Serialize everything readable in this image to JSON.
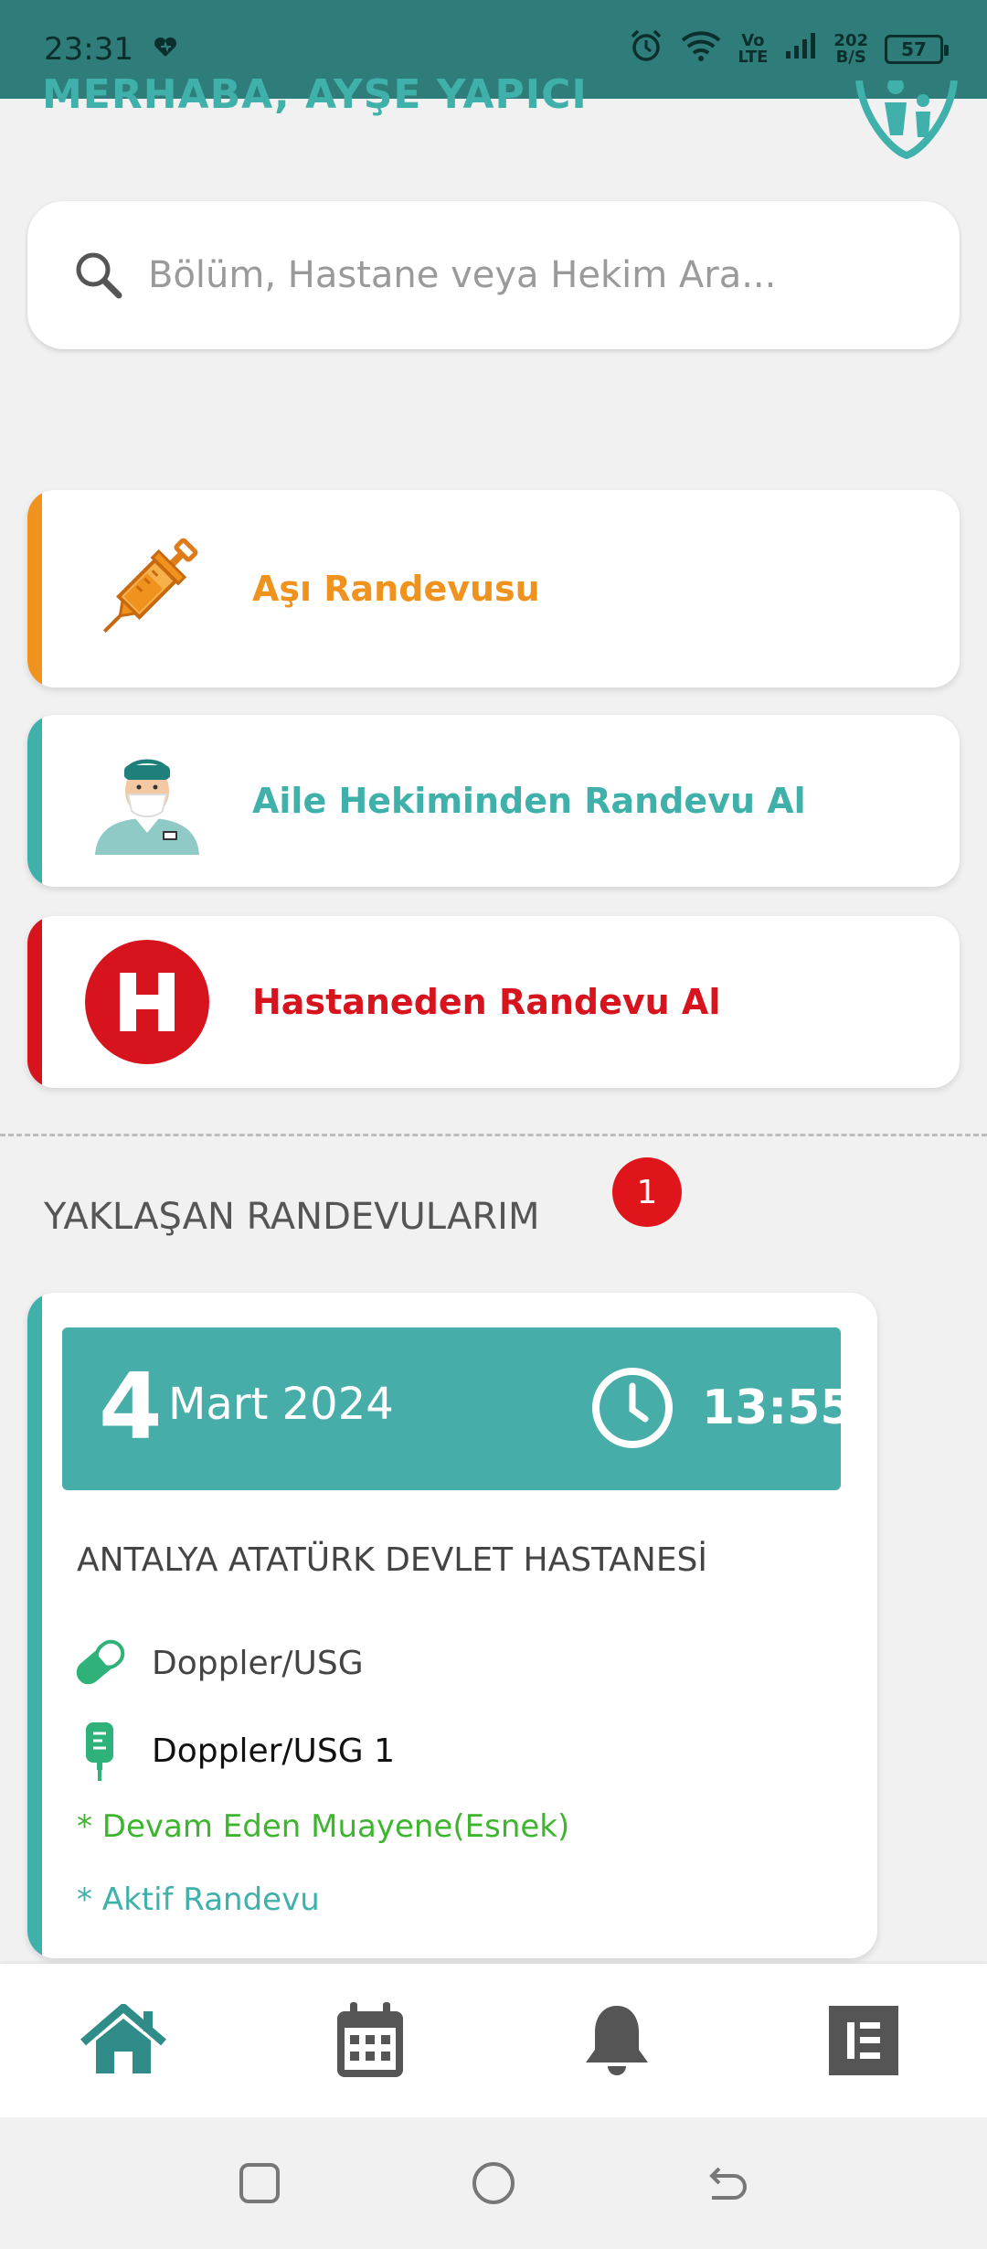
{
  "status_bar": {
    "time": "23:31",
    "volte_top": "Vo",
    "volte_bottom": "LTE",
    "speed_top": "202",
    "speed_bottom": "B/S",
    "battery": "57"
  },
  "header": {
    "greeting": "MERHABA, AYŞE YAPICI"
  },
  "search": {
    "placeholder": "Bölüm, Hastane veya Hekim Ara..."
  },
  "actions": [
    {
      "label": "Aşı Randevusu",
      "color": "#f0921e",
      "icon": "syringe-icon"
    },
    {
      "label": "Aile Hekiminden Randevu Al",
      "color": "#3fb0aa",
      "icon": "doctor-icon"
    },
    {
      "label": "Hastaneden Randevu Al",
      "color": "#d7141d",
      "icon": "hospital-h-icon"
    }
  ],
  "upcoming": {
    "title": "YAKLAŞAN RANDEVULARIM",
    "count": "1",
    "appointment": {
      "day": "4",
      "month_year": "Mart 2024",
      "time": "13:55",
      "hospital": "ANTALYA ATATÜRK DEVLET HASTANESİ",
      "department": "Doppler/USG",
      "clinic": "Doppler/USG 1",
      "status_note": "* Devam Eden Muayene(Esnek)",
      "active_note": "* Aktif Randevu"
    }
  },
  "bottom_nav": [
    "home-icon",
    "calendar-icon",
    "bell-icon",
    "menu-icon"
  ],
  "colors": {
    "accent": "#3fb0aa",
    "status_bar": "#2e7d7a",
    "orange": "#f0921e",
    "red": "#d7141d",
    "green": "#3db52f"
  }
}
